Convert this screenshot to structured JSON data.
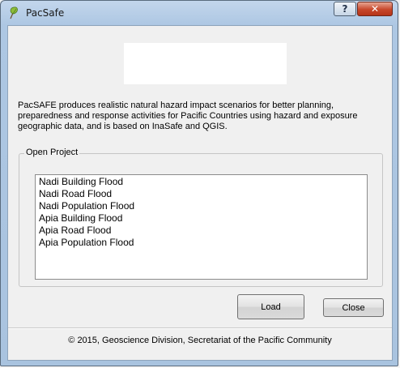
{
  "window": {
    "title": "PacSafe",
    "help_label": "?",
    "close_label": "✕"
  },
  "description": "PacSAFE produces realistic natural hazard impact scenarios for better planning, preparedness and response activities for Pacific Countries using hazard and exposure geographic data, and is based on InaSafe and QGIS.",
  "open_project": {
    "group_title": "Open Project",
    "items": [
      "Nadi Building Flood",
      "Nadi Road Flood",
      "Nadi Population Flood",
      "Apia Building Flood",
      "Apia Road Flood",
      "Apia Population Flood"
    ]
  },
  "buttons": {
    "load_label": "Load",
    "close_label": "Close"
  },
  "footer": "© 2015, Geoscience Division, Secretariat of the Pacific Community",
  "colors": {
    "title_bar": "#adc7e3",
    "close_button": "#c7472a",
    "dialog_bg": "#f0f0f0"
  },
  "icons": {
    "app": "qgis-leaf-icon",
    "help": "question-mark-icon",
    "close": "close-x-icon"
  }
}
